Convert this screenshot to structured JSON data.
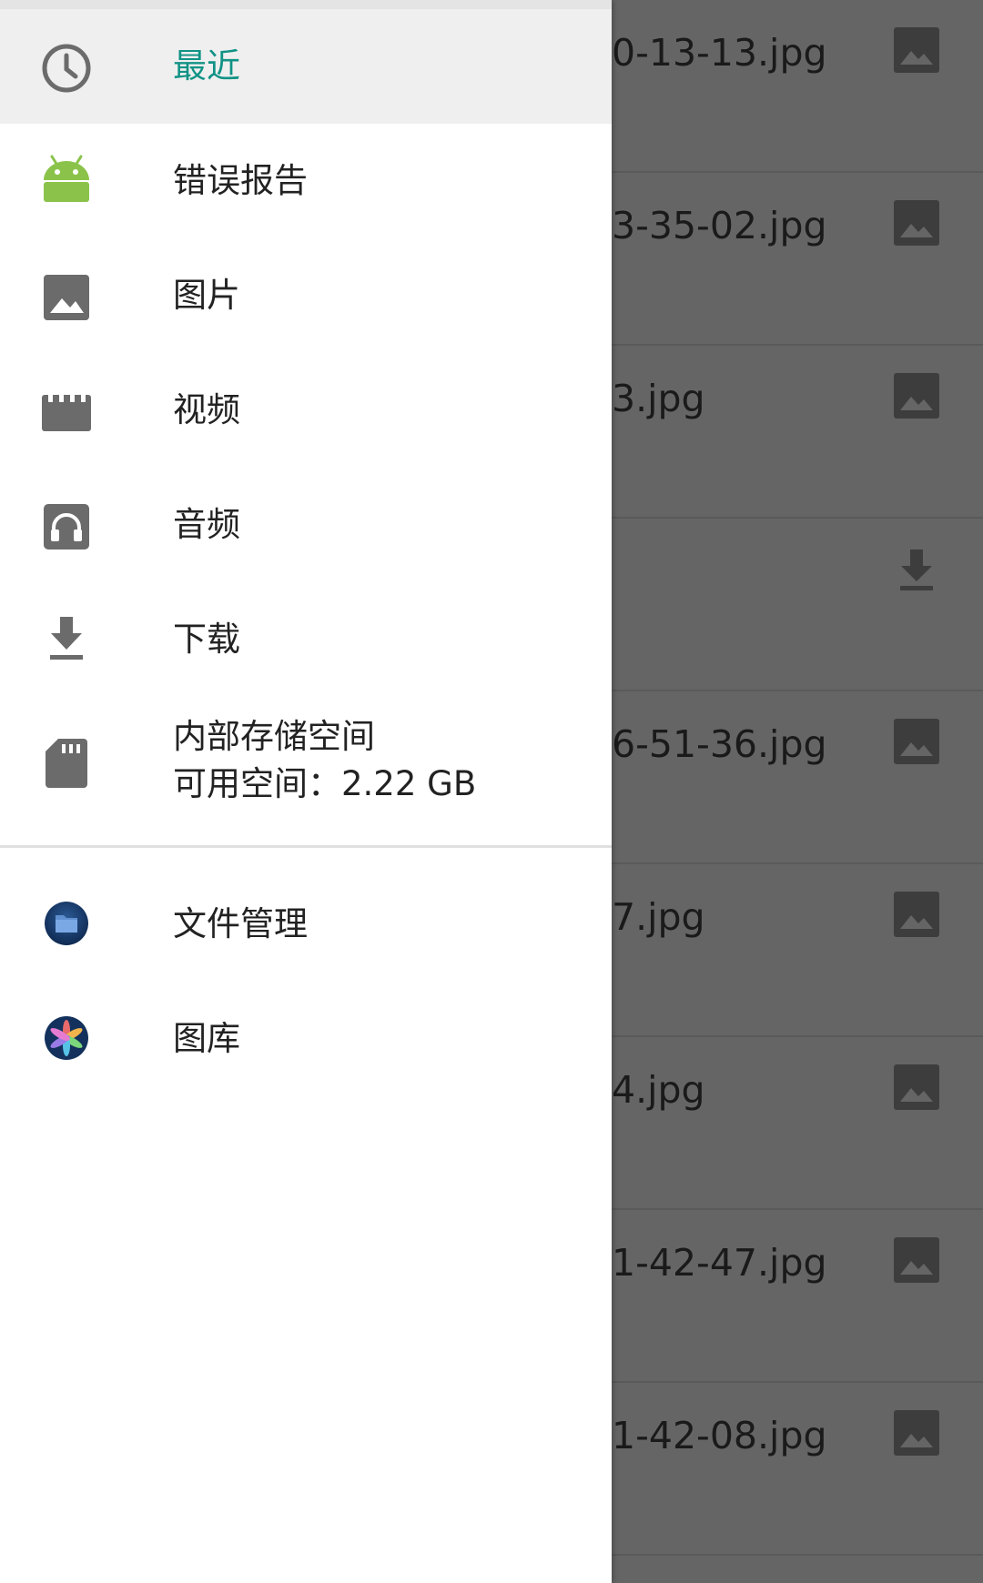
{
  "drawer": {
    "items": [
      {
        "label": "最近",
        "icon": "clock-icon",
        "active": true
      },
      {
        "label": "错误报告",
        "icon": "android-icon"
      },
      {
        "label": "图片",
        "icon": "image-icon"
      },
      {
        "label": "视频",
        "icon": "video-icon"
      },
      {
        "label": "音频",
        "icon": "audio-icon"
      },
      {
        "label": "下载",
        "icon": "download-icon"
      },
      {
        "label": "内部存储空间",
        "sublabel": "可用空间：2.22 GB",
        "icon": "sd-card-icon"
      }
    ],
    "apps": [
      {
        "label": "文件管理",
        "icon": "file-manager-app-icon"
      },
      {
        "label": "图库",
        "icon": "gallery-app-icon"
      }
    ]
  },
  "files": [
    {
      "name": "0-13-13.jpg",
      "icon": "image-icon"
    },
    {
      "name": "3-35-02.jpg",
      "icon": "image-icon"
    },
    {
      "name": "3.jpg",
      "icon": "image-icon"
    },
    {
      "name": "",
      "icon": "download-icon"
    },
    {
      "name": "6-51-36.jpg",
      "icon": "image-icon"
    },
    {
      "name": "7.jpg",
      "icon": "image-icon"
    },
    {
      "name": "4.jpg",
      "icon": "image-icon"
    },
    {
      "name": "1-42-47.jpg",
      "icon": "image-icon"
    },
    {
      "name": "1-42-08.jpg",
      "icon": "image-icon"
    }
  ],
  "colors": {
    "accent": "#119385",
    "scrim": "#656565",
    "icon_gray": "#6b6b6b",
    "android_green": "#8bc34a"
  }
}
